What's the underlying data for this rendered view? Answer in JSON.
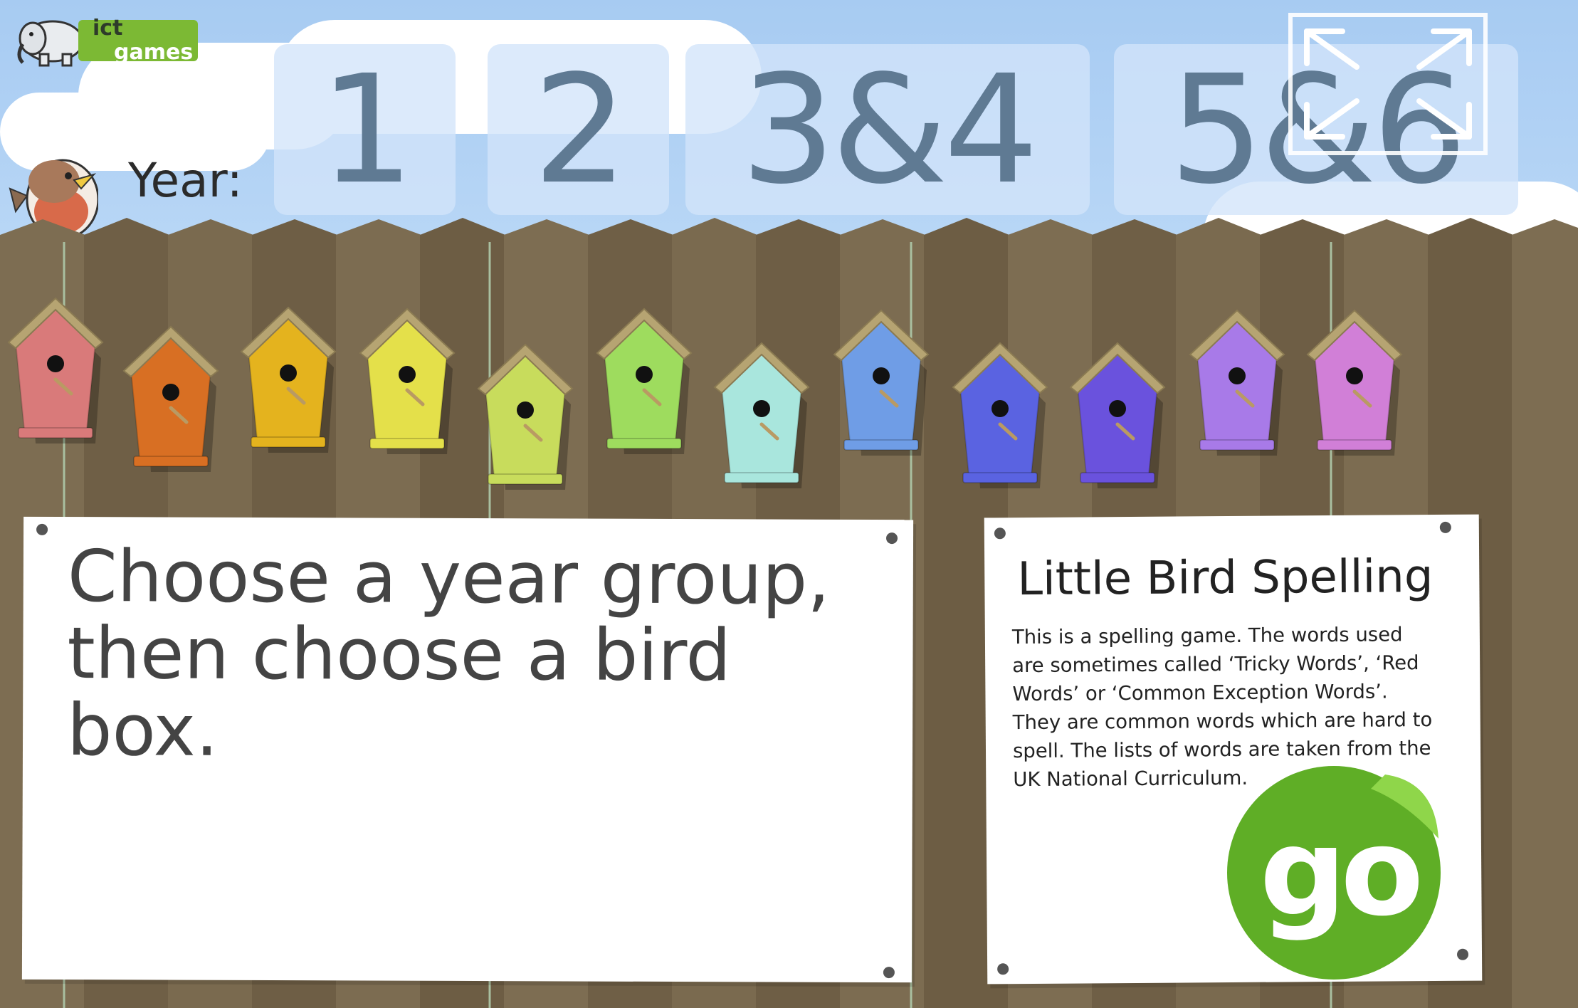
{
  "logo": {
    "ict": "ict",
    "games": "games"
  },
  "year_selector": {
    "label": "Year:",
    "options": [
      "1",
      "2",
      "3&4",
      "5&6"
    ]
  },
  "bird_boxes": [
    {
      "color": "#d97a7a"
    },
    {
      "color": "#d86f23"
    },
    {
      "color": "#e4b31e"
    },
    {
      "color": "#e4e04a"
    },
    {
      "color": "#c8dc5c"
    },
    {
      "color": "#9edc5e"
    },
    {
      "color": "#a9e6dd"
    },
    {
      "color": "#6f9de6"
    },
    {
      "color": "#5a63e1"
    },
    {
      "color": "#6a52dd"
    },
    {
      "color": "#a87ae8"
    },
    {
      "color": "#d17fd7"
    }
  ],
  "instructions": "Choose a year group, then choose a bird box.",
  "info": {
    "title": "Little Bird Spelling",
    "description": "This is a spelling game. The words used are sometimes called ‘Tricky Words’, ‘Red Words’ or ‘Common Exception Words’. They are common words which are hard to spell. The lists of words are taken from the UK National Curriculum."
  },
  "go_button": {
    "label": "go",
    "color": "#5fae26"
  },
  "colors": {
    "sky": "#a9cdf3",
    "fence": "#7a6a4f",
    "fence_dark": "#5e503a",
    "notice": "#ffffff"
  },
  "icons": {
    "fullscreen": "expand-arrows-icon",
    "bird": "robin-icon",
    "logo": "elephant-icon"
  }
}
